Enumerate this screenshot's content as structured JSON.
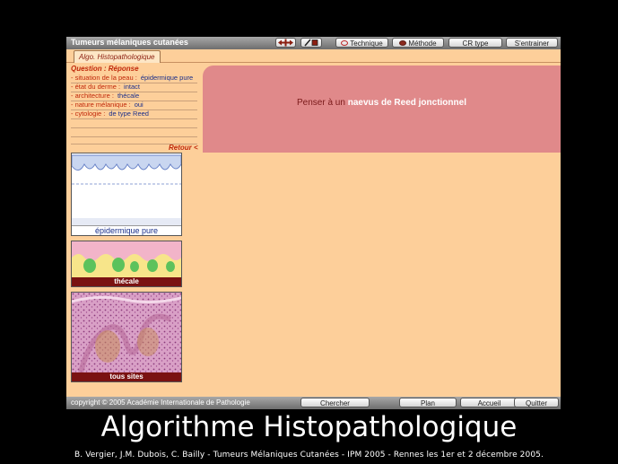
{
  "app": {
    "title": "Tumeurs mélaniques cutanées",
    "toolbar": {
      "move_icon": "arrows-move-icon",
      "tools_icon": "tool-pair-icon",
      "technique_label": "Technique",
      "methode_label": "Méthode",
      "cr_type_label": "CR type",
      "sentrainer_label": "S'entrainer"
    },
    "tab_label": "Algo. Histopathologique"
  },
  "questions": {
    "header": "Question : Réponse",
    "rows": [
      {
        "label": "- situation de la peau :",
        "value": "épidermique pure"
      },
      {
        "label": "- état du derme :",
        "value": "intact"
      },
      {
        "label": "- architecture :",
        "value": "thécale"
      },
      {
        "label": "- nature mélanique :",
        "value": "oui"
      },
      {
        "label": "- cytologie :",
        "value": "de type Reed"
      }
    ],
    "retour_label": "Retour <"
  },
  "images": [
    {
      "caption": "épidermique pure"
    },
    {
      "caption": "thécale"
    },
    {
      "caption": "tous sites"
    }
  ],
  "answer": {
    "prefix": "Penser à un",
    "highlight": "naevus de Reed jonctionnel"
  },
  "statusbar": {
    "copyright": "copyright © 2005 Académie Internationale de Pathologie",
    "chercher_label": "Chercher",
    "plan_label": "Plan",
    "accueil_label": "Accueil",
    "quitter_label": "Quitter"
  },
  "slide": {
    "title": "Algorithme Histopathologique",
    "credits": "B. Vergier, J.M. Dubois, C. Bailly - Tumeurs Mélaniques Cutanées - IPM 2005 - Rennes les 1er et 2 décembre 2005."
  },
  "colors": {
    "app_bg": "#fdcf9a",
    "answer_bg": "#e0898a",
    "label_red": "#c0280a",
    "value_blue": "#1a2f8a",
    "caption_bg": "#7a1212"
  }
}
